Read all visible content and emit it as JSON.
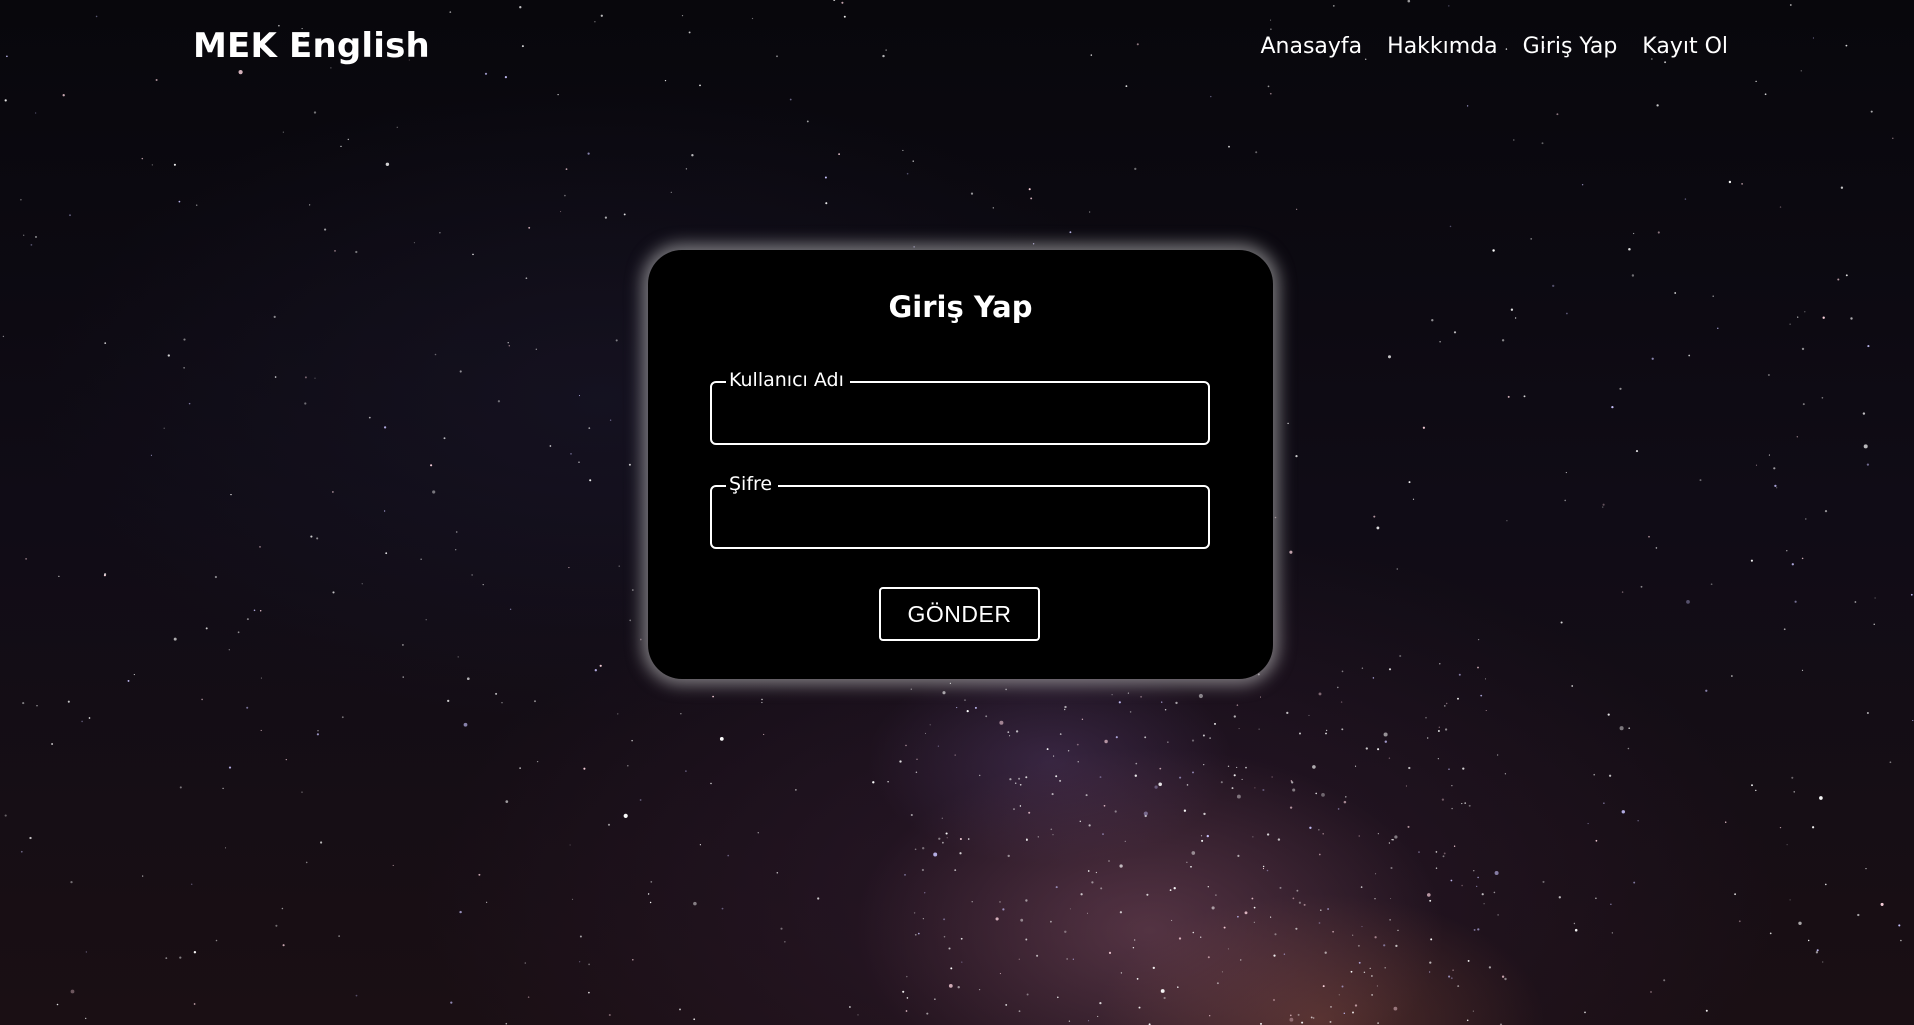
{
  "header": {
    "brand": "MEK English",
    "nav": [
      {
        "label": "Anasayfa"
      },
      {
        "label": "Hakkımda"
      },
      {
        "label": "Giriş Yap"
      },
      {
        "label": "Kayıt Ol"
      }
    ]
  },
  "login_form": {
    "title": "Giriş Yap",
    "username": {
      "label": "Kullanıcı Adı",
      "value": ""
    },
    "password": {
      "label": "Şifre",
      "value": ""
    },
    "submit_label": "GÖNDER"
  },
  "colors": {
    "card_background": "#000000",
    "text": "#ffffff",
    "card_glow": "#cdcdcd"
  }
}
